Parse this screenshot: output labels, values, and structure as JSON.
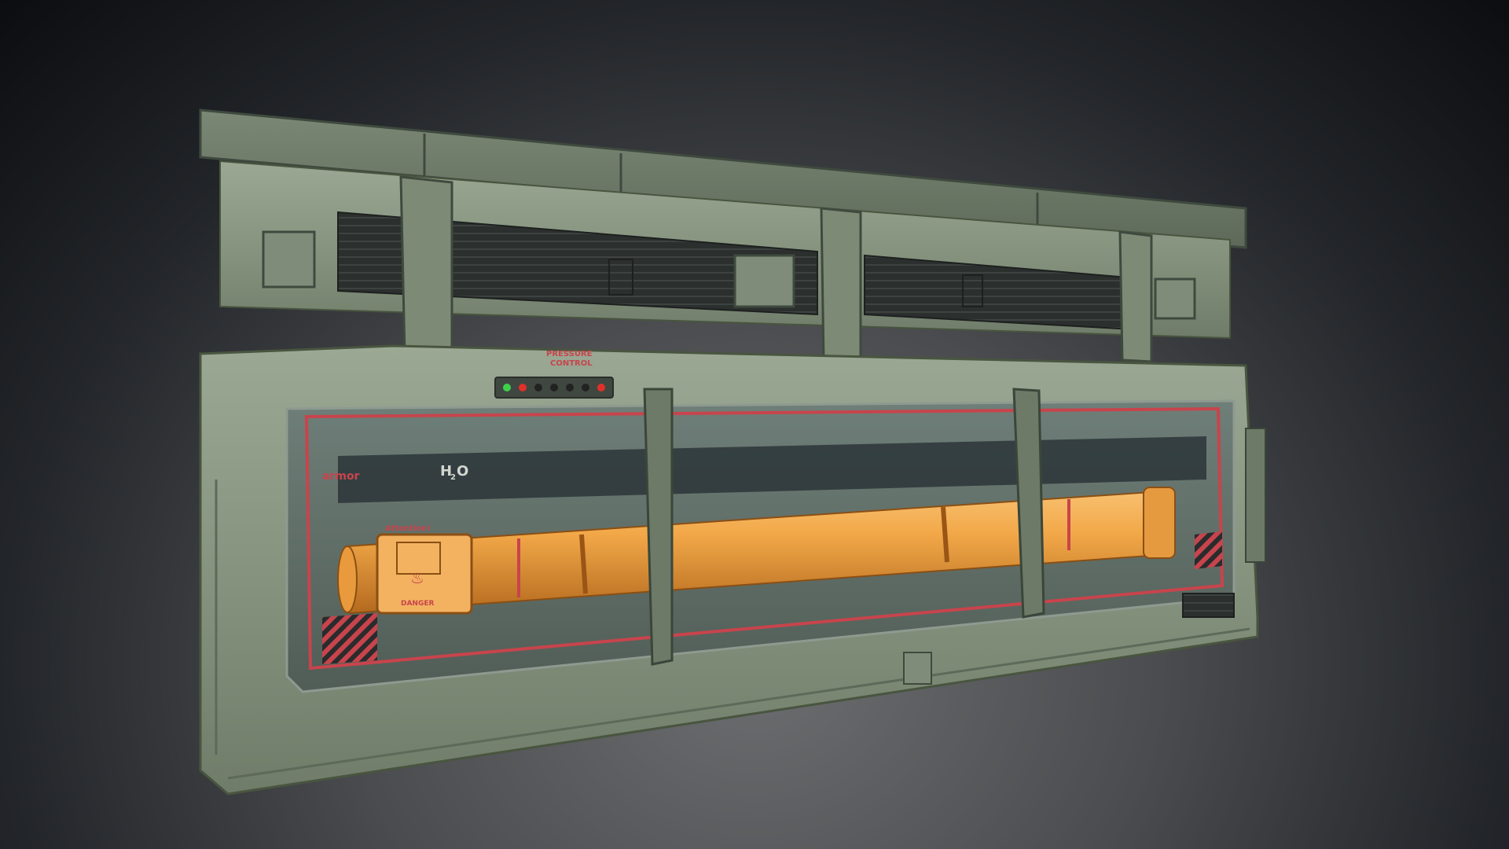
{
  "image": {
    "subject": "sci-fi-pressure-container-3d-render",
    "colors": {
      "background_center": "#6c6e70",
      "background_edge": "#0b0d10",
      "hull_green": "#8b9a84",
      "hull_dark": "#5d6a5a",
      "vent_dark": "#2a2e2c",
      "glass_red_trim": "#c8444c",
      "tube_orange": "#f0a040",
      "led_red": "#e0302a",
      "led_green": "#3ed04a"
    }
  },
  "decals": {
    "pressure_line1": "PRESSURE",
    "pressure_line2": "CONTROL",
    "armor": "armor",
    "h2": "H",
    "h2_sub": "2",
    "o": "O",
    "attention": "Attention!",
    "danger": "DANGER"
  },
  "panel": {
    "led_colors": [
      "#3ed04a",
      "#e0302a",
      "#222",
      "#222",
      "#222",
      "#222",
      "#e0302a"
    ]
  }
}
